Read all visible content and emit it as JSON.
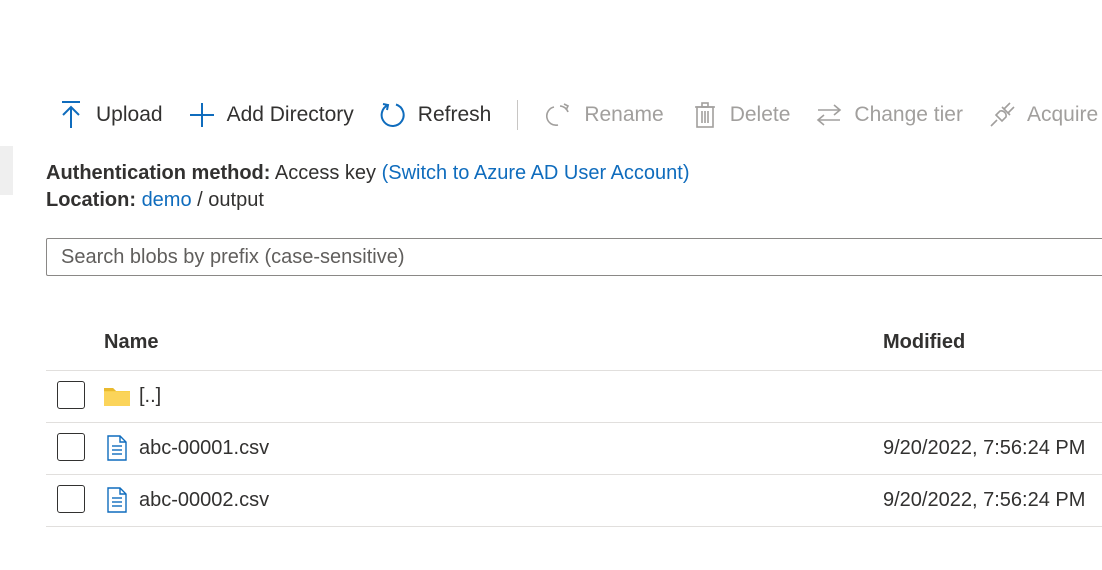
{
  "toolbar": {
    "upload": "Upload",
    "add_directory": "Add Directory",
    "refresh": "Refresh",
    "rename": "Rename",
    "delete": "Delete",
    "change_tier": "Change tier",
    "acquire_lease": "Acquire le"
  },
  "auth": {
    "label": "Authentication method:",
    "value": "Access key",
    "switch_link": "(Switch to Azure AD User Account)"
  },
  "location": {
    "label": "Location:",
    "root": "demo",
    "separator": "/",
    "current": "output"
  },
  "search": {
    "placeholder": "Search blobs by prefix (case-sensitive)"
  },
  "table": {
    "headers": {
      "name": "Name",
      "modified": "Modified"
    },
    "rows": [
      {
        "name": "[..]",
        "modified": "",
        "icon": "folder-icon"
      },
      {
        "name": "abc-00001.csv",
        "modified": "9/20/2022, 7:56:24 PM",
        "icon": "file-icon"
      },
      {
        "name": "abc-00002.csv",
        "modified": "9/20/2022, 7:56:24 PM",
        "icon": "file-icon"
      }
    ]
  },
  "colors": {
    "accent": "#0f6cbd",
    "disabled": "#a19f9d",
    "folder": "#f8d04a"
  }
}
